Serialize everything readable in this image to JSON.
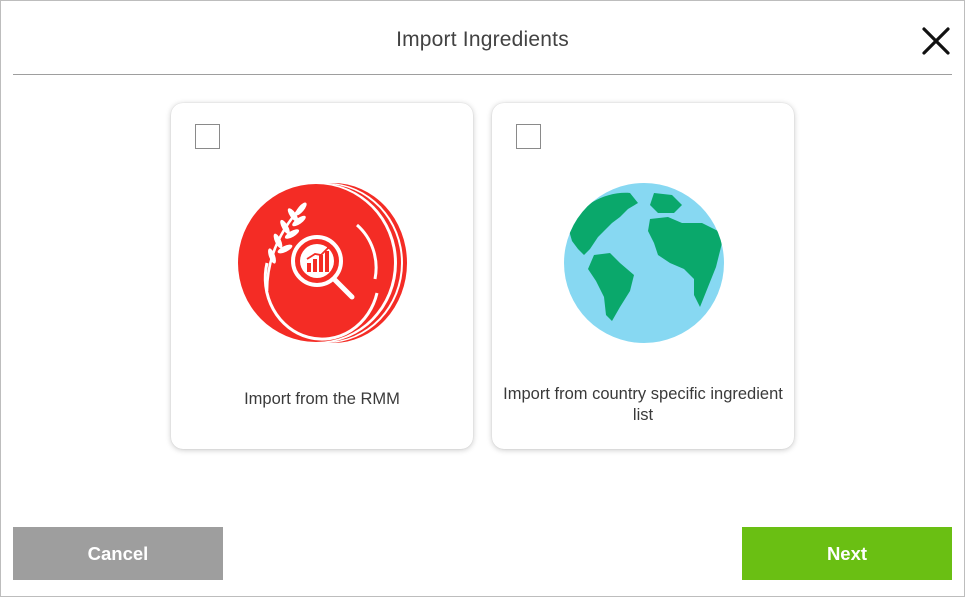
{
  "dialog": {
    "title": "Import Ingredients",
    "close_icon": "close-icon"
  },
  "options": [
    {
      "label": "Import from the RMM",
      "checked": false,
      "icon": "rmm-wheat-magnifier-icon",
      "icon_color": "#f42c25"
    },
    {
      "label": "Import from country specific ingredient list",
      "checked": false,
      "icon": "globe-icon",
      "ocean_color": "#87d8f2",
      "land_color": "#0aa86b"
    }
  ],
  "footer": {
    "cancel_label": "Cancel",
    "next_label": "Next",
    "cancel_color": "#9e9e9e",
    "next_color": "#6abf13"
  }
}
